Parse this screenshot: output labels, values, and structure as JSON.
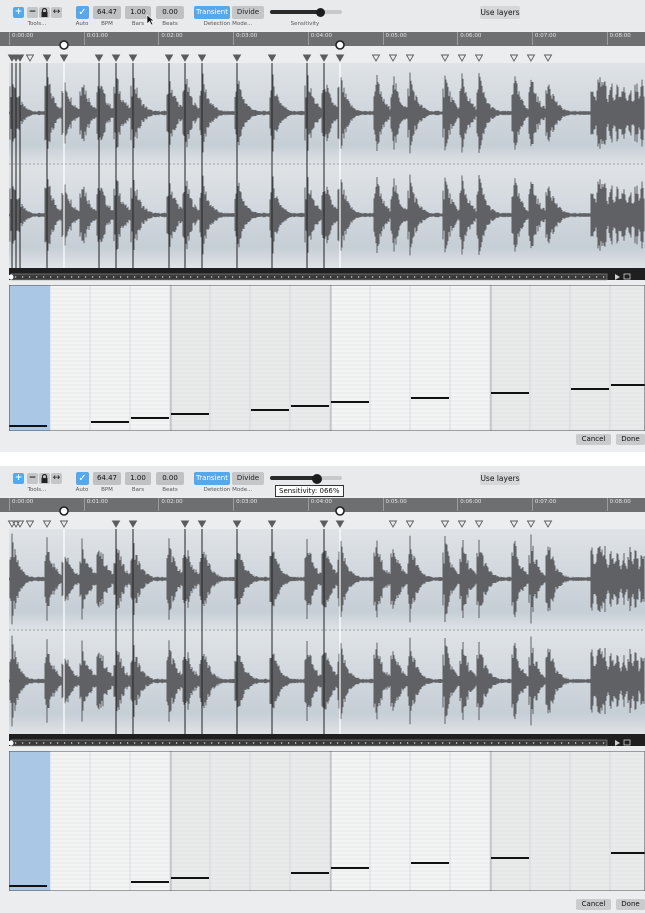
{
  "toolbar": {
    "plus_icon": "+",
    "minus_icon": "−",
    "lock_icon": "lock-icon",
    "arrows_icon": "↔",
    "tools_label": "Tools...",
    "auto_check": "✓",
    "auto_label": "Auto",
    "bpm_value": "64.47",
    "bpm_label": "BPM",
    "bars_value": "1.00",
    "bars_label": "Bars",
    "beats_value": "0.00",
    "beats_label": "Beats",
    "transient_label": "Transient",
    "divide_label": "Divide",
    "detection_mode_label": "Detection Mode...",
    "sensitivity_label": "Sensitivity",
    "use_layers_label": "Use layers"
  },
  "ruler": {
    "ticks": [
      "0:00:00",
      "0:01:00",
      "0:02:00",
      "0:03:00",
      "0:04:00",
      "0:05:00",
      "0:06:00",
      "0:07:00",
      "0:08:00"
    ]
  },
  "panel_top": {
    "sensitivity_level": 0.7
  },
  "panel_bottom": {
    "sensitivity_level": 0.66,
    "tooltip": "Sensitivity: 066%"
  },
  "footer": {
    "cancel_label": "Cancel",
    "done_label": "Done"
  },
  "colors": {
    "accent": "#57a8ea",
    "waveform": "#5f6165",
    "ruler": "#6d6f71",
    "selection": "#aac8e6"
  }
}
